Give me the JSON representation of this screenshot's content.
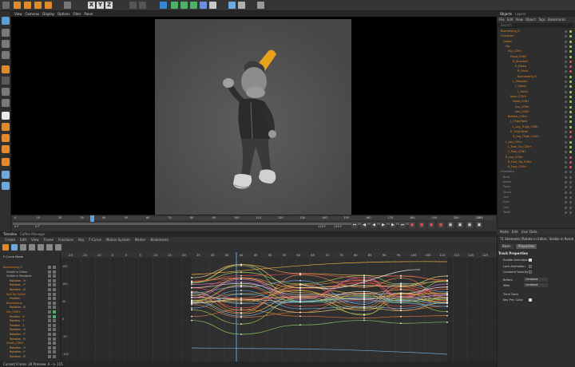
{
  "toolbar": {
    "axes": [
      "X",
      "Y",
      "Z"
    ],
    "icons": [
      "undo-icon",
      "live-select-icon",
      "move-icon",
      "scale-icon",
      "rotate-icon",
      "model-mode-icon",
      "render-view-icon",
      "render-settings-icon",
      "cube-icon",
      "spline-icon",
      "generator-icon",
      "deformer-icon",
      "camera-icon",
      "light-icon",
      "environment-icon",
      "tag-icon",
      "python-icon"
    ]
  },
  "viewport": {
    "menu": [
      "View",
      "Cameras",
      "Display",
      "Options",
      "Filter",
      "Panel"
    ]
  },
  "object_manager": {
    "tabs": [
      "Objects",
      "Layers"
    ],
    "menu": [
      "File",
      "Edit",
      "View",
      "Object",
      "Tags",
      "Bookmarks"
    ],
    "search_placeholder": "Search",
    "items": [
      {
        "label": "Boomerang_R",
        "indent": 1,
        "status": "#7fd04a"
      },
      {
        "label": "Character",
        "indent": 1,
        "status": "#7fd04a"
      },
      {
        "label": "Global",
        "indent": 2,
        "status": "#7fd04a"
      },
      {
        "label": "Hip",
        "indent": 3,
        "status": "#7fd04a"
      },
      {
        "label": "Hip_CON+",
        "indent": 4,
        "status": "#7fd04a"
      },
      {
        "label": "Head_CON+",
        "indent": 5,
        "status": "#7fd04a"
      },
      {
        "label": "R_Shoulder",
        "indent": 6,
        "status": "#e34b4b"
      },
      {
        "label": "R_Elbow",
        "indent": 7,
        "status": "#e34b4b"
      },
      {
        "label": "R_Hand",
        "indent": 8,
        "status": "#e34b4b"
      },
      {
        "label": "Boomerang_R",
        "indent": 8,
        "status": "#7fd04a"
      },
      {
        "label": "L_Shoulder",
        "indent": 6,
        "status": "#7fd04a"
      },
      {
        "label": "L_Elbow",
        "indent": 7,
        "status": "#7fd04a"
      },
      {
        "label": "L_Hand",
        "indent": 8,
        "status": "#7fd04a"
      },
      {
        "label": "Neck_CON+",
        "indent": 5,
        "status": "#7fd04a"
      },
      {
        "label": "Head_CON+",
        "indent": 6,
        "status": "#7fd04a"
      },
      {
        "label": "Eye_CON+",
        "indent": 7,
        "status": "#7fd04a"
      },
      {
        "label": "Jaw_CON+",
        "indent": 7,
        "status": "#7fd04a"
      },
      {
        "label": "Bottom_CON+",
        "indent": 4,
        "status": "#7fd04a"
      },
      {
        "label": "L_ThighTwist",
        "indent": 5,
        "status": "#7fd04a"
      },
      {
        "label": "L_Leg_Thigh_CON+",
        "indent": 6,
        "status": "#7fd04a"
      },
      {
        "label": "R_ThighTwist",
        "indent": 5,
        "status": "#e34b4b"
      },
      {
        "label": "R_Leg_Thigh_CON+",
        "indent": 6,
        "status": "#e34b4b"
      },
      {
        "label": "L_Leg_CON+",
        "indent": 3,
        "status": "#7fd04a"
      },
      {
        "label": "L_Foot_Tip_CON+",
        "indent": 4,
        "status": "#7fd04a"
      },
      {
        "label": "L_Foot_CON+",
        "indent": 4,
        "status": "#7fd04a"
      },
      {
        "label": "R_Leg_CON+",
        "indent": 3,
        "status": "#e34b4b"
      },
      {
        "label": "R_Foot_Tip_CON+",
        "indent": 4,
        "status": "#e34b4b"
      },
      {
        "label": "R_Foot_CON+",
        "indent": 4,
        "status": "#e34b4b"
      },
      {
        "label": "Geometry",
        "indent": 1,
        "status": "#5c5c5c"
      },
      {
        "label": "Body",
        "indent": 2,
        "status": "#5c5c5c"
      },
      {
        "label": "Jacket",
        "indent": 2,
        "status": "#5c5c5c"
      },
      {
        "label": "Pants",
        "indent": 2,
        "status": "#5c5c5c"
      },
      {
        "label": "Shoes",
        "indent": 2,
        "status": "#5c5c5c"
      },
      {
        "label": "Hair",
        "indent": 2,
        "status": "#5c5c5c"
      },
      {
        "label": "Eyes",
        "indent": 2,
        "status": "#5c5c5c"
      },
      {
        "label": "Cap",
        "indent": 2,
        "status": "#5c5c5c"
      },
      {
        "label": "Teeth",
        "indent": 2,
        "status": "#5c5c5c"
      }
    ]
  },
  "attribute_manager": {
    "menu": [
      "Mode",
      "Edit",
      "User Data"
    ],
    "path": "71 Elements [Rotate in Editor, Visible in Renderer, Rot...",
    "tabs": [
      "Basic",
      "Properties"
    ],
    "section": "Track Properties",
    "fields": [
      {
        "label": "Enable Animation",
        "type": "check"
      },
      {
        "label": "Lock Animation",
        "type": "check-off"
      },
      {
        "label": "Constant Velocity",
        "type": "check-off"
      },
      {
        "label": "Before",
        "type": "select",
        "value": "Constant"
      },
      {
        "label": "After",
        "type": "select",
        "value": "Constant"
      },
      {
        "label": "Time Track",
        "type": "text"
      },
      {
        "label": "Key Pre. Color",
        "type": "check"
      }
    ]
  },
  "timeline": {
    "header_tabs": [
      "Timeline",
      "Coffee Manager"
    ],
    "menu": [
      "Create",
      "Edit",
      "View",
      "Frame",
      "Functions",
      "Key",
      "F-Curve",
      "Motion System",
      "Marker",
      "Bookmarks"
    ],
    "tree_title": "F-Curve Mode",
    "tree": [
      {
        "label": "Boomerang_R",
        "indent": 0,
        "color": "#e08a2b"
      },
      {
        "label": "Visible in Editor",
        "indent": 1,
        "color": "#bdbdbd"
      },
      {
        "label": "Visible in Renderer",
        "indent": 1,
        "color": "#bdbdbd"
      },
      {
        "label": "Rotation . H",
        "indent": 2,
        "color": "#e0a050"
      },
      {
        "label": "Rotation . P",
        "indent": 2,
        "color": "#e0a050"
      },
      {
        "label": "Rotation . B",
        "indent": 2,
        "color": "#e0a050"
      },
      {
        "label": "Null for Spline",
        "indent": 1,
        "color": "#e08a2b"
      },
      {
        "label": "Position",
        "indent": 2,
        "color": "#e0a050"
      },
      {
        "label": "Boomerang",
        "indent": 1,
        "color": "#e08a2b"
      },
      {
        "label": "Rotation . B",
        "indent": 2,
        "color": "#e0a050"
      },
      {
        "label": "Hip_CON+",
        "indent": 1,
        "color": "#e08a2b"
      },
      {
        "label": "Position . X",
        "indent": 2,
        "color": "#e0a050"
      },
      {
        "label": "Position . Y",
        "indent": 2,
        "color": "#e0a050"
      },
      {
        "label": "Position . Z",
        "indent": 2,
        "color": "#e0a050"
      },
      {
        "label": "Rotation . H",
        "indent": 2,
        "color": "#e0a050"
      },
      {
        "label": "Rotation . P",
        "indent": 2,
        "color": "#e0a050"
      },
      {
        "label": "Rotation . B",
        "indent": 2,
        "color": "#e0a050"
      },
      {
        "label": "Chest_CON+",
        "indent": 1,
        "color": "#e08a2b"
      },
      {
        "label": "Rotation . H",
        "indent": 2,
        "color": "#e0a050"
      },
      {
        "label": "Rotation . P",
        "indent": 2,
        "color": "#e0a050"
      },
      {
        "label": "Rotation . B",
        "indent": 2,
        "color": "#e0a050"
      }
    ],
    "ruler_labels": [
      "-20",
      "-15",
      "-10",
      "-5",
      "0",
      "5",
      "10",
      "15",
      "20",
      "25",
      "30",
      "35",
      "40",
      "45",
      "50",
      "55",
      "60",
      "65",
      "70",
      "75",
      "80",
      "85",
      "90",
      "95",
      "100",
      "105",
      "110",
      "115",
      "120",
      "125"
    ],
    "value_labels": [
      "150",
      "100",
      "50",
      "0",
      "-50",
      "-100"
    ],
    "status": "Current Frame:  26   Preview:  0 --> 115"
  },
  "time_slider": {
    "ruler_labels": [
      "0",
      "10",
      "20",
      "30",
      "40",
      "50",
      "60",
      "70",
      "80",
      "90",
      "100",
      "110",
      "120",
      "130",
      "140",
      "150",
      "160",
      "170",
      "180",
      "190",
      "200",
      "210"
    ],
    "end_label": "255",
    "current_frame": "0 F",
    "min_field": "0 F",
    "max_field": "115 F",
    "max_field_2": "115 F"
  }
}
